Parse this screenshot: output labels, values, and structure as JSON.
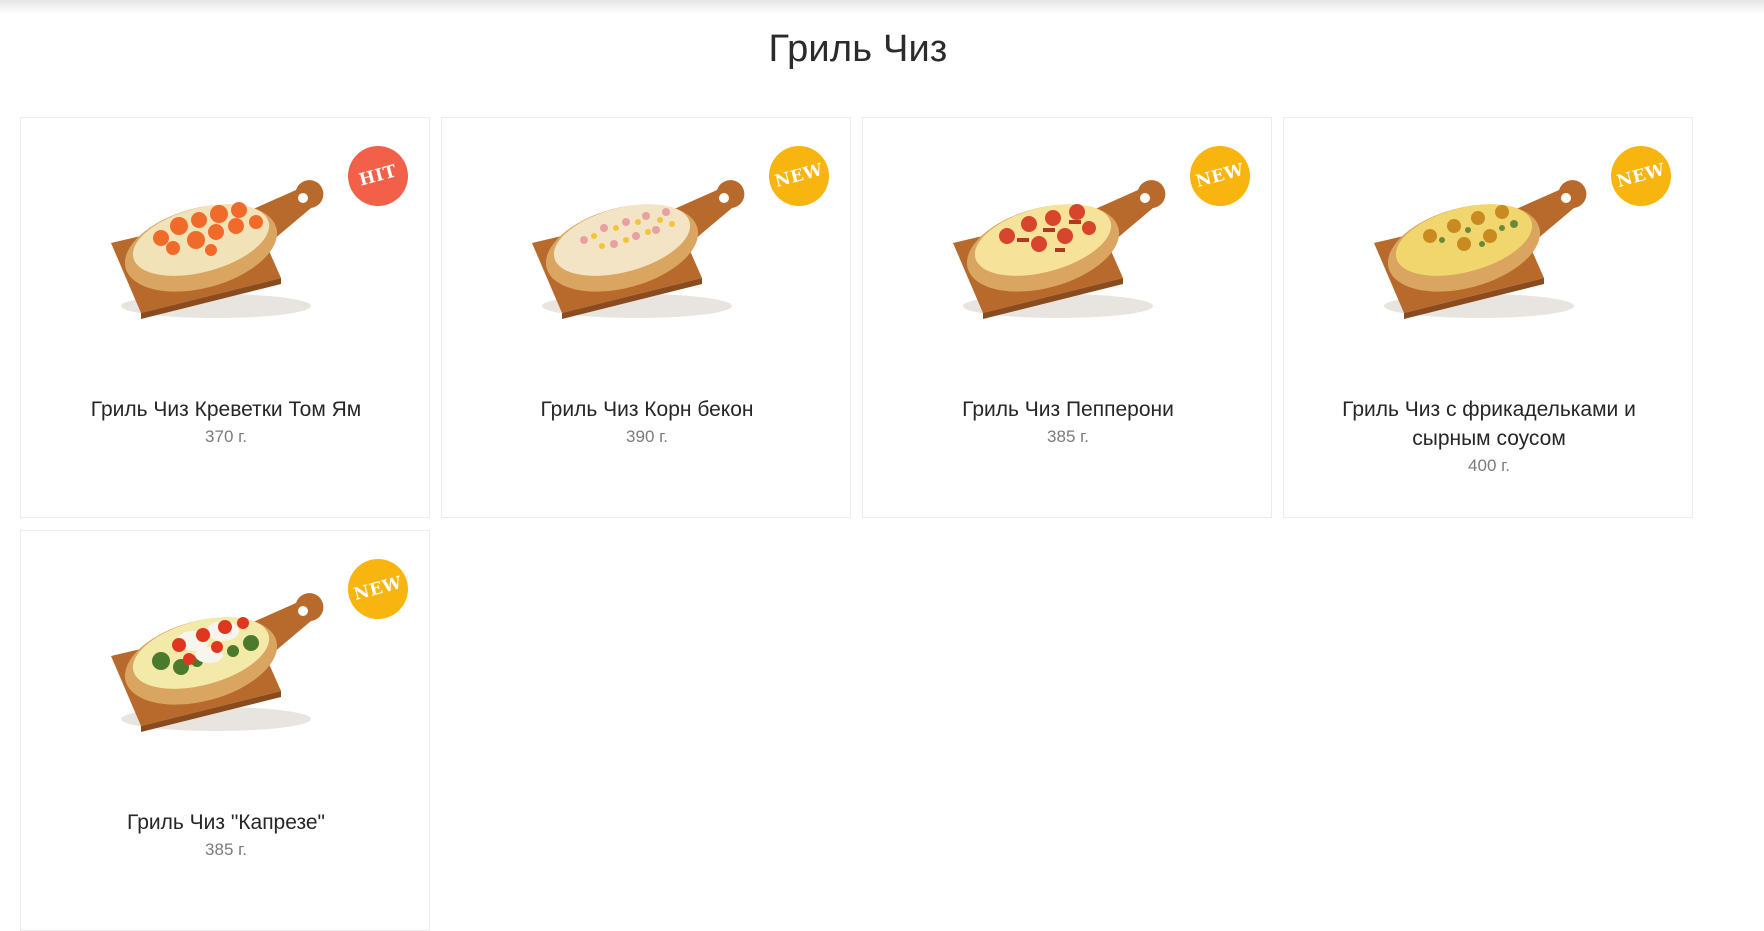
{
  "page": {
    "title": "Гриль Чиз"
  },
  "colors": {
    "hit_badge": "#f2604a",
    "new_badge": "#f8b40f",
    "board": "#b8692c",
    "title_text": "#2b2b2b"
  },
  "products": [
    {
      "name": "Гриль Чиз Креветки Том Ям",
      "weight": "370 г.",
      "badge": "HIT",
      "topping": "shrimp"
    },
    {
      "name": "Гриль Чиз Корн бекон",
      "weight": "390 г.",
      "badge": "NEW",
      "topping": "corn-bacon"
    },
    {
      "name": "Гриль Чиз Пепперони",
      "weight": "385 г.",
      "badge": "NEW",
      "topping": "pepperoni"
    },
    {
      "name": "Гриль Чиз с фрикадельками и сырным соусом",
      "weight": "400 г.",
      "badge": "NEW",
      "topping": "meatballs"
    },
    {
      "name": "Гриль Чиз  \"Капрезе\"",
      "weight": "385 г.",
      "badge": "NEW",
      "topping": "caprese"
    }
  ]
}
